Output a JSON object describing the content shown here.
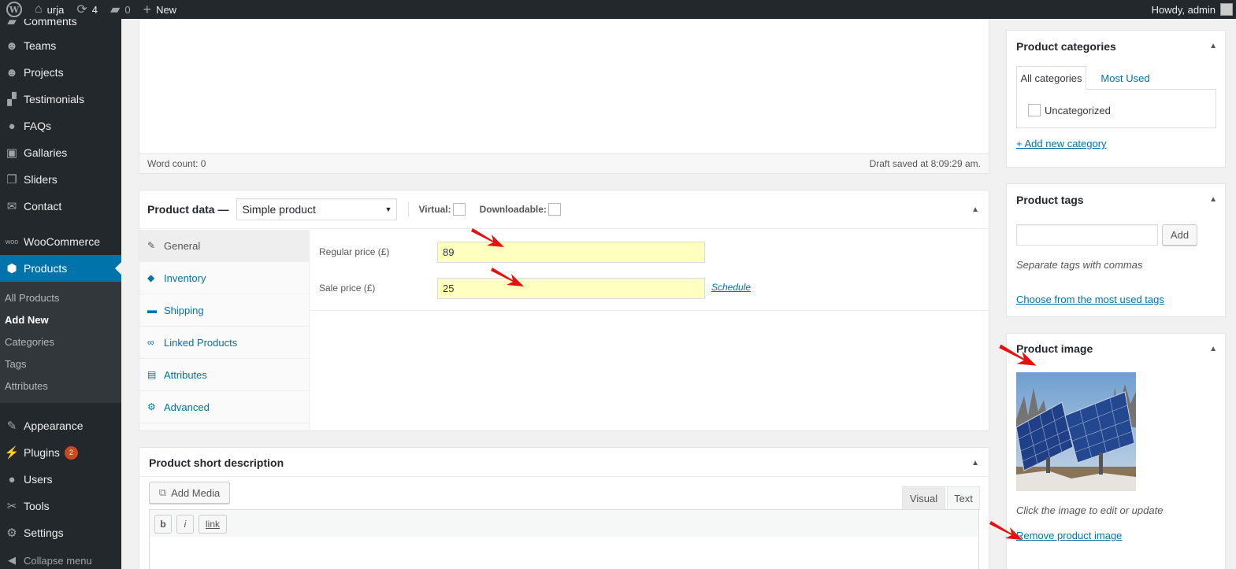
{
  "adminbar": {
    "site_name": "urja",
    "updates_count": "4",
    "comments_count": "0",
    "new_label": "New",
    "greeting": "Howdy, admin"
  },
  "sidebar": {
    "items": [
      {
        "label": "Comments",
        "icon": "comments-icon"
      },
      {
        "label": "Teams",
        "icon": "teams-icon"
      },
      {
        "label": "Projects",
        "icon": "projects-icon"
      },
      {
        "label": "Testimonials",
        "icon": "testimonials-icon"
      },
      {
        "label": "FAQs",
        "icon": "faq-icon"
      },
      {
        "label": "Gallaries",
        "icon": "gallery-icon"
      },
      {
        "label": "Sliders",
        "icon": "sliders-icon"
      },
      {
        "label": "Contact",
        "icon": "mail-icon"
      },
      {
        "label": "WooCommerce",
        "icon": "woocommerce-icon"
      },
      {
        "label": "Products",
        "icon": "products-icon"
      },
      {
        "label": "Appearance",
        "icon": "appearance-icon"
      },
      {
        "label": "Plugins",
        "icon": "plugins-icon",
        "badge": "2"
      },
      {
        "label": "Users",
        "icon": "users-icon"
      },
      {
        "label": "Tools",
        "icon": "tools-icon"
      },
      {
        "label": "Settings",
        "icon": "settings-icon"
      }
    ],
    "submenu": [
      "All Products",
      "Add New",
      "Categories",
      "Tags",
      "Attributes"
    ],
    "collapse_label": "Collapse menu"
  },
  "editor": {
    "word_count": "Word count: 0",
    "draft_saved": "Draft saved at 8:09:29 am."
  },
  "product_data": {
    "title": "Product data —",
    "type_selected": "Simple product",
    "virtual_label": "Virtual:",
    "downloadable_label": "Downloadable:",
    "tabs": [
      "General",
      "Inventory",
      "Shipping",
      "Linked Products",
      "Attributes",
      "Advanced"
    ],
    "regular_price_label": "Regular price (£)",
    "regular_price_value": "89",
    "sale_price_label": "Sale price (£)",
    "sale_price_value": "25",
    "schedule_label": "Schedule"
  },
  "short_description": {
    "title": "Product short description",
    "add_media": "Add Media",
    "visual_tab": "Visual",
    "text_tab": "Text",
    "qt_buttons": [
      "b",
      "i",
      "link"
    ]
  },
  "categories": {
    "title": "Product categories",
    "tab_all": "All categories",
    "tab_most_used": "Most Used",
    "items": [
      "Uncategorized"
    ],
    "add_new": "+ Add new category"
  },
  "tags": {
    "title": "Product tags",
    "add_button": "Add",
    "hint": "Separate tags with commas",
    "choose_link": "Choose from the most used tags"
  },
  "product_image": {
    "title": "Product image",
    "hint": "Click the image to edit or update",
    "remove_link": "Remove product image"
  },
  "colors": {
    "admin_bg": "#23282d",
    "accent": "#0073aa",
    "highlight_input": "#ffffc0",
    "annotation_arrow": "#e8100f"
  }
}
